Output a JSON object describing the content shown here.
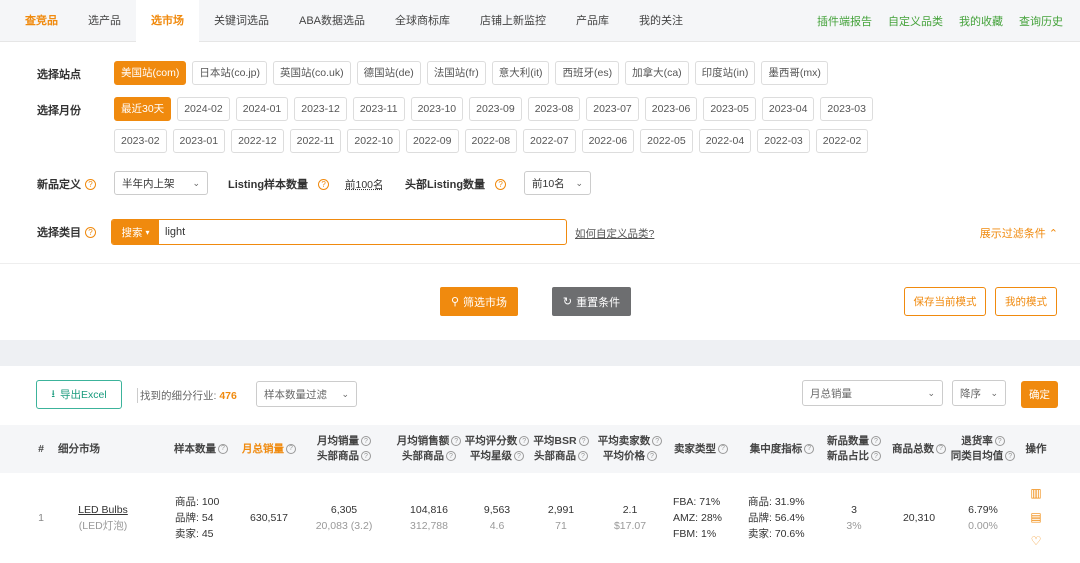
{
  "nav": {
    "brand": "查竞品",
    "tabs": [
      "选产品",
      "选市场",
      "关键词选品",
      "ABA数据选品",
      "全球商标库",
      "店铺上新监控",
      "产品库",
      "我的关注"
    ],
    "active": "选市场",
    "right": [
      "插件端报告",
      "自定义品类",
      "我的收藏",
      "查询历史"
    ]
  },
  "filters": {
    "site_label": "选择站点",
    "sites": [
      "美国站(com)",
      "日本站(co.jp)",
      "英国站(co.uk)",
      "德国站(de)",
      "法国站(fr)",
      "意大利(it)",
      "西班牙(es)",
      "加拿大(ca)",
      "印度站(in)",
      "墨西哥(mx)"
    ],
    "month_label": "选择月份",
    "months_row1": [
      "最近30天",
      "2024-02",
      "2024-01",
      "2023-12",
      "2023-11",
      "2023-10",
      "2023-09",
      "2023-08",
      "2023-07",
      "2023-06",
      "2023-05",
      "2023-04",
      "2023-03"
    ],
    "months_row2": [
      "2023-02",
      "2023-01",
      "2022-12",
      "2022-11",
      "2022-10",
      "2022-09",
      "2022-08",
      "2022-07",
      "2022-06",
      "2022-05",
      "2022-04",
      "2022-03",
      "2022-02"
    ],
    "newdef_label": "新品定义",
    "newdef_value": "半年内上架",
    "sample_label": "Listing样本数量",
    "sample_value": "前100名",
    "head_label": "头部Listing数量",
    "head_value": "前10名",
    "category_label": "选择类目",
    "search_btn": "搜索",
    "search_value": "light",
    "howto_link": "如何自定义品类?",
    "expand_label": "展示过滤条件"
  },
  "actions": {
    "filter": "筛选市场",
    "reset": "重置条件",
    "save_mode": "保存当前模式",
    "my_mode": "我的模式"
  },
  "toolbar": {
    "export": "导出Excel",
    "found_label": "找到的细分行业:",
    "found_count": "476",
    "sample_filter": "样本数量过滤",
    "sort_field": "月总销量",
    "sort_order": "降序",
    "confirm": "确定"
  },
  "table": {
    "headers": [
      [
        "#"
      ],
      [
        "细分市场"
      ],
      [
        "样本数量"
      ],
      [
        "月总销量"
      ],
      [
        "月均销量",
        "头部商品"
      ],
      [
        "月均销售额",
        "头部商品"
      ],
      [
        "平均评分数",
        "平均星级"
      ],
      [
        "平均BSR",
        "头部商品"
      ],
      [
        "平均卖家数",
        "平均价格"
      ],
      [
        "卖家类型"
      ],
      [
        "集中度指标"
      ],
      [
        "新品数量",
        "新品占比"
      ],
      [
        "商品总数"
      ],
      [
        "退货率",
        "同类目均值"
      ],
      [
        "操作"
      ]
    ],
    "rows": [
      {
        "idx": "1",
        "market": "LED Bulbs",
        "market_cn": "(LED灯泡)",
        "sample": [
          "商品: 100",
          "品牌: 54",
          "卖家: 45"
        ],
        "total_sales": "630,517",
        "avg_sales": "6,305",
        "avg_sales_head": "20,083 (3.2)",
        "avg_rev": "104,816",
        "avg_rev_head": "312,788",
        "avg_reviews": "9,563",
        "avg_stars": "4.6",
        "avg_bsr": "2,991",
        "avg_bsr_head": "71",
        "avg_sellers": "2.1",
        "avg_price": "$17.07",
        "seller_types": [
          "FBA: 71%",
          "AMZ: 28%",
          "FBM: 1%"
        ],
        "concentration": [
          "商品: 31.9%",
          "品牌: 56.4%",
          "卖家: 70.6%"
        ],
        "new_count": "3",
        "new_ratio": "3%",
        "total_products": "20,310",
        "return_rate": "6.79%",
        "return_avg": "0.00%"
      }
    ]
  },
  "colors": {
    "accent": "#f08a0e",
    "green": "#44a23a",
    "gray_button": "#6d6e70"
  }
}
